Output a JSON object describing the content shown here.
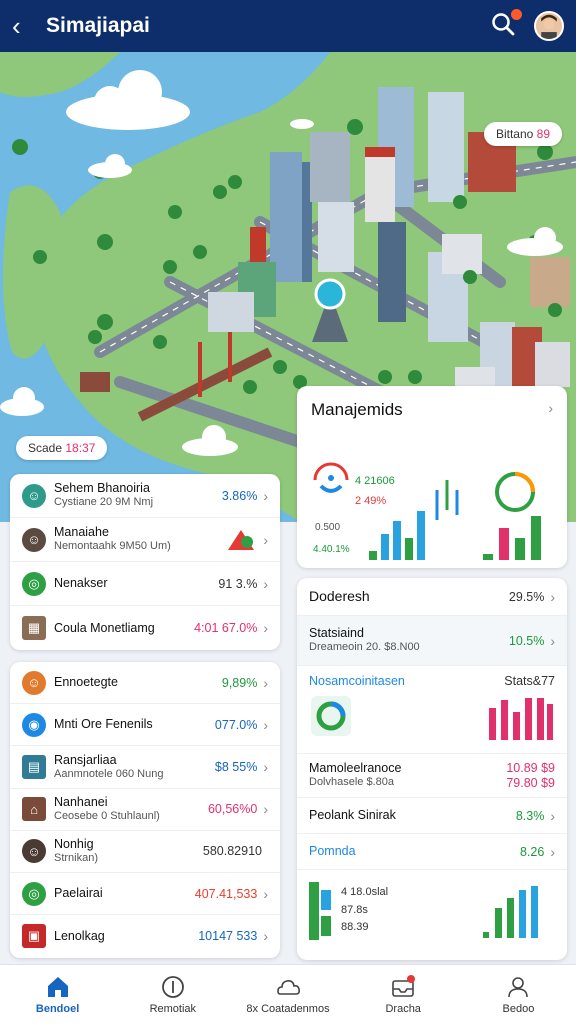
{
  "header": {
    "back_label": "‹",
    "title": "Simajiapai"
  },
  "map": {
    "badge_top": {
      "text": "Bittano",
      "value": "89"
    },
    "badge_left": {
      "text": "Scade",
      "value": "18:37"
    }
  },
  "left_card_1": {
    "rows": [
      {
        "icon": "person-avatar-icon",
        "title": "Sehem Bhanoiria",
        "subtitle": "Cystiane 20 9M Nmj",
        "value": "3.86%",
        "color": "#1665c1"
      },
      {
        "icon": "person-avatar-icon",
        "title": "Manaiahe",
        "subtitle": "Nemontaahk 9M50 Um)",
        "value": "",
        "color": "#333"
      },
      {
        "icon": "green-circle-icon",
        "title": "Nenakser",
        "subtitle": "",
        "value": "91 3.%",
        "color": "#333"
      },
      {
        "icon": "building-icon",
        "title": "Coula Monetliamg",
        "subtitle": "",
        "value": "4:01 67.0%",
        "color": "#e2306c"
      }
    ]
  },
  "left_card_2": {
    "rows": [
      {
        "icon": "orange-avatar-icon",
        "title": "Ennoetegte",
        "subtitle": "",
        "value": "9,89%",
        "color": "#1a9b3a"
      },
      {
        "icon": "blue-circle-icon",
        "title": "Mnti Ore Fenenils",
        "subtitle": "",
        "value": "077.0%",
        "color": "#1665c1"
      },
      {
        "icon": "map-icon",
        "title": "Ransjarliaa",
        "subtitle": "Aanmnotele 060 Nung",
        "value": "$8 55%",
        "color": "#1665c1"
      },
      {
        "icon": "house-icon",
        "title": "Nanhanei",
        "subtitle": "Ceosebe 0 Stuhlaunl)",
        "value": "60,56%0",
        "color": "#e2306c"
      },
      {
        "icon": "person-avatar-icon",
        "title": "Nonhig",
        "subtitle": "Strnikan)",
        "value": "580.82910",
        "color": "#333"
      },
      {
        "icon": "green-circle-icon",
        "title": "Paelairai",
        "subtitle": "",
        "value": "407.41,533",
        "color": "#e8402c"
      },
      {
        "icon": "shield-icon",
        "title": "Lenolkag",
        "subtitle": "",
        "value": "10147 533",
        "color": "#1665c1"
      }
    ]
  },
  "right_card_1": {
    "title": "Manajemids",
    "gauge_labels": [
      "4 21606",
      "2 49%",
      "0.500",
      "4.40.1%"
    ],
    "bars_left": [
      12,
      25,
      42,
      55,
      38,
      65
    ],
    "bars_right": [
      22,
      48,
      38,
      60
    ],
    "colors": {
      "green": "#2ea043",
      "blue": "#29a3e0",
      "pink": "#e2306c"
    }
  },
  "right_card_2": {
    "rows": [
      {
        "title": "Doderesh",
        "subtitle": "",
        "value": "29.5%",
        "color": "#333"
      },
      {
        "title": "Statsiaind",
        "subtitle": "Dreameoin 20. $8.N00",
        "value": "10.5%",
        "color": "#1a9b3a"
      },
      {
        "title": "Nosamcoinitasen",
        "subtitle": "",
        "value": "Stats&77",
        "color": "#333"
      },
      {
        "title": "Mamoleelranoce",
        "subtitle": "Dolvhasele $.80a",
        "value": "10.89 $9",
        "value2": "79.80 $9",
        "color": "#e2306c"
      },
      {
        "title": "Peolank Sinirak",
        "subtitle": "",
        "value": "8.3%",
        "color": "#1a9b3a"
      },
      {
        "title": "Pomnda",
        "subtitle": "",
        "value": "8.26",
        "color": "#1a9b3a"
      }
    ],
    "legend_lines": [
      "4 18.0slal",
      "87.8s",
      "88.39"
    ]
  },
  "nav": {
    "items": [
      {
        "label": "Bendoel",
        "icon": "home-icon",
        "active": true
      },
      {
        "label": "Remotiak",
        "icon": "coin-icon",
        "active": false
      },
      {
        "label": "8x Coatadenmos",
        "icon": "cloud-icon",
        "active": false
      },
      {
        "label": "Dracha",
        "icon": "inbox-icon",
        "active": false
      },
      {
        "label": "Bedoo",
        "icon": "profile-icon",
        "active": false
      }
    ]
  }
}
